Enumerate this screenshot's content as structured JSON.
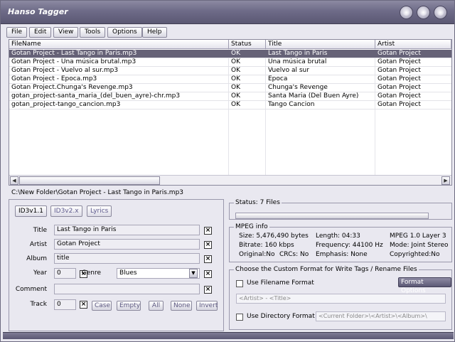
{
  "window": {
    "title": "Hanso Tagger"
  },
  "menu": [
    "File",
    "Edit",
    "View",
    "Tools",
    "Options",
    "Help"
  ],
  "filelist": {
    "columns": [
      "FileName",
      "Status",
      "Title",
      "Artist"
    ],
    "rows": [
      [
        "Gotan Project - Last Tango in Paris.mp3",
        "OK",
        "Last Tango in Paris",
        "Gotan Project"
      ],
      [
        "Gotan Project - Una música brutal.mp3",
        "OK",
        "Una música brutal",
        "Gotan Project"
      ],
      [
        "Gotan Project - Vuelvo al sur.mp3",
        "OK",
        "Vuelvo al sur",
        "Gotan Project"
      ],
      [
        "Gotan Project - Época.mp3",
        "OK",
        "Época",
        "Gotan Project"
      ],
      [
        "Gotan Project.Chunga's Revenge.mp3",
        "OK",
        "Chunga's Revenge",
        "Gotan Project"
      ],
      [
        "gotan_project-santa_maria_(del_buen_ayre)-chr.mp3",
        "OK",
        "Santa Maria (Del Buen Ayre)",
        "Gotan Project"
      ],
      [
        "gotan_project-tango_cancion.mp3",
        "OK",
        "Tango Cancion",
        "Gotan Project"
      ]
    ],
    "selected_index": 0
  },
  "current_path": "C:\\New Folder\\Gotan Project - Last Tango in Paris.mp3",
  "tag_tabs": [
    "ID3v1.1",
    "ID3v2.x",
    "Lyrics"
  ],
  "tag_fields": {
    "title_label": "Title",
    "title_value": "Last Tango in Paris",
    "artist_label": "Artist",
    "artist_value": "Gotan Project",
    "album_label": "Album",
    "album_value": "title",
    "year_label": "Year",
    "year_value": "0",
    "genre_label": "Genre",
    "genre_value": "Blues",
    "comment_label": "Comment",
    "comment_value": "",
    "track_label": "Track",
    "track_value": "0"
  },
  "case_buttons": [
    "Case",
    "Empty",
    "All",
    "None",
    "Invert"
  ],
  "status": {
    "label": "Status: 7 Files"
  },
  "mpeg": {
    "title": "MPEG info",
    "size": "Size: 5,476,490 bytes",
    "length": "Length: 04:33",
    "layer": "MPEG 1.0 Layer 3",
    "bitrate": "Bitrate: 160 kbps",
    "frequency": "Frequency: 44100 Hz",
    "mode": "Mode: Joint Stereo",
    "original": "Original:No",
    "crcs": "CRCs: No",
    "emphasis": "Emphasis: None",
    "copyrighted": "Copyrighted:No"
  },
  "format": {
    "title": "Choose the Custom Format for Write Tags / Rename Files",
    "filename_label": "Use Filename Format",
    "options_button": "Format Options",
    "filename_pattern": "<Artist> - <Title>",
    "directory_label": "Use Directory Format",
    "directory_pattern": "<Current Folder>\\<Artist>\\<Album>\\"
  },
  "colors": {
    "selection": "#666277",
    "titlebar": "#6e6b88",
    "window_bg": "#e9e8f0"
  }
}
